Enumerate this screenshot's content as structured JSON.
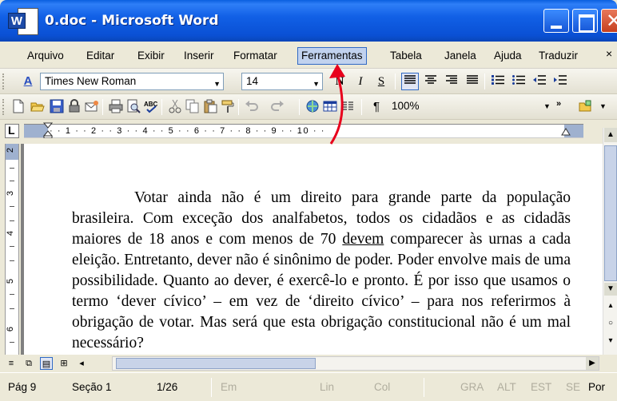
{
  "window": {
    "title": "0.doc - Microsoft Word",
    "app_icon_letter": "W"
  },
  "menubar": {
    "items": [
      {
        "label": "Arquivo"
      },
      {
        "label": "Editar"
      },
      {
        "label": "Exibir"
      },
      {
        "label": "Inserir"
      },
      {
        "label": "Formatar"
      },
      {
        "label": "Ferramentas"
      },
      {
        "label": "Tabela"
      },
      {
        "label": "Janela"
      },
      {
        "label": "Ajuda"
      },
      {
        "label": "Traduzir"
      }
    ],
    "active_item": "Ferramentas",
    "close_glyph": "×"
  },
  "format_toolbar": {
    "style_icon": "A",
    "font_name": "Times New Roman",
    "font_size": "14",
    "bold": "N",
    "italic": "I",
    "underline": "S",
    "alignment": "justify"
  },
  "standard_toolbar": {
    "zoom": "100%",
    "pilcrow": "¶"
  },
  "ruler": {
    "tab_selector": "L",
    "marks": "· · 1 · · 2 · · 3 · · 4 · · 5 · · 6 · · 7 · · 8 · · 9 · · 10 · ·",
    "vertical_numbers": [
      "2",
      "3",
      "4",
      "5",
      "6"
    ]
  },
  "document": {
    "paragraph_before_underline": "Votar ainda não é um direito para grande parte da população brasileira. Com exceção dos analfabetos, todos os cidadãos e as cidadãs maiores de 18 anos e com menos de 70 ",
    "underlined_word": "devem",
    "paragraph_after_underline": " comparecer às urnas a cada eleição. Entretanto, dever não é sinônimo de poder. Poder envolve mais de uma possibilidade. Quanto ao dever, é exercê-lo e pronto. É por isso que usamos o termo ‘dever cívico’ – em vez de ‘direito cívico’ – para nos referirmos à obrigação de votar. Mas será que esta obrigação constitucional não é um mal necessário?"
  },
  "statusbar": {
    "page": "Pág 9",
    "section": "Seção 1",
    "page_count": "1/26",
    "at": "Em",
    "line": "Lin",
    "column": "Col",
    "rec": "GRA",
    "trk": "ALT",
    "ext": "EST",
    "ovr": "SE",
    "language": "Por"
  },
  "colors": {
    "titlebar": "#0a50d4",
    "menu_highlight": "#c1d2ee",
    "annotation_arrow": "#e8001c"
  },
  "icons": [
    "word-app-icon",
    "minimize-icon",
    "maximize-icon",
    "close-icon",
    "styles-icon",
    "new-doc-icon",
    "open-icon",
    "save-icon",
    "permission-icon",
    "email-icon",
    "print-icon",
    "print-preview-icon",
    "spelling-icon",
    "cut-icon",
    "copy-icon",
    "paste-icon",
    "format-painter-icon",
    "undo-icon",
    "redo-icon",
    "hyperlink-icon",
    "table-icon",
    "columns-icon",
    "toolbar-options-icon",
    "research-icon"
  ]
}
